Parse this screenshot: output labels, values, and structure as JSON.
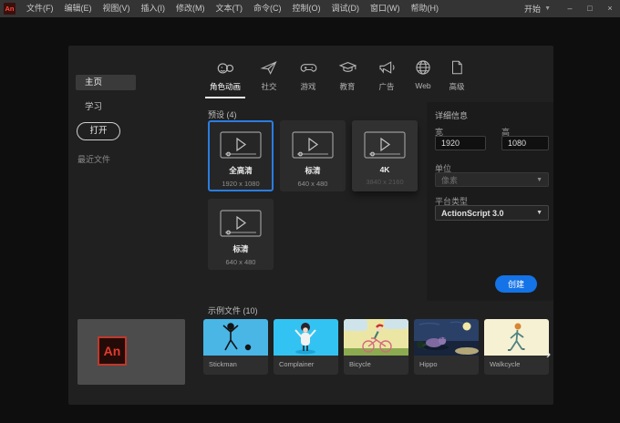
{
  "titlebar": {
    "app_logo": "An",
    "menus": [
      "文件(F)",
      "编辑(E)",
      "视图(V)",
      "插入(I)",
      "修改(M)",
      "文本(T)",
      "命令(C)",
      "控制(O)",
      "调试(D)",
      "窗口(W)",
      "帮助(H)"
    ],
    "workspace_label": "开始",
    "workspace_caret": "▼",
    "minimize": "–",
    "maximize": "□",
    "close": "×"
  },
  "sidebar": {
    "home": "主页",
    "learn": "学习",
    "open_button": "打开",
    "recent_label": "最近文件"
  },
  "tabs": [
    {
      "label": "角色动画",
      "icon": "character-icon",
      "selected": true
    },
    {
      "label": "社交",
      "icon": "paper-plane-icon",
      "selected": false
    },
    {
      "label": "游戏",
      "icon": "gamepad-icon",
      "selected": false
    },
    {
      "label": "教育",
      "icon": "graduation-cap-icon",
      "selected": false
    },
    {
      "label": "广告",
      "icon": "megaphone-icon",
      "selected": false
    },
    {
      "label": "Web",
      "icon": "globe-icon",
      "selected": false
    },
    {
      "label": "高级",
      "icon": "document-icon",
      "selected": false
    }
  ],
  "presets": {
    "heading": "预设 (4)",
    "items": [
      {
        "name": "全高清",
        "dims": "1920 x 1080",
        "selected": true
      },
      {
        "name": "标清",
        "dims": "640 x 480",
        "selected": false
      },
      {
        "name": "4K",
        "dims": "3840 x 2160",
        "selected": false
      },
      {
        "name": "标清",
        "dims": "640 x 480",
        "selected": false
      }
    ]
  },
  "details": {
    "heading": "详细信息",
    "width_label": "宽",
    "width_value": "1920",
    "height_label": "高",
    "height_value": "1080",
    "unit_label": "单位",
    "unit_value": "像素",
    "unit_caret": "▼",
    "platform_label": "平台类型",
    "platform_value": "ActionScript 3.0",
    "platform_caret": "▼",
    "create_button": "创建"
  },
  "samples": {
    "heading": "示例文件 (10)",
    "items": [
      {
        "name": "Stickman"
      },
      {
        "name": "Complainer"
      },
      {
        "name": "Bicycle"
      },
      {
        "name": "Hippo"
      },
      {
        "name": "Walkcycle"
      }
    ],
    "next_arrow": "›"
  },
  "brand": {
    "logo_text": "An"
  },
  "colors": {
    "accent_blue": "#1473e6",
    "selection_border": "#2a7de1",
    "menubar_bg": "#343434",
    "panel_bg": "#202020",
    "card_bg": "#2b2b2b"
  }
}
